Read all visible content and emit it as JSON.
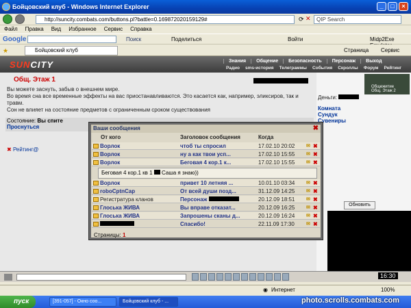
{
  "window": {
    "title": "Бойцовский клуб - Windows Internet Explorer"
  },
  "address": {
    "url": "http://suncity.combats.com/buttons.pl?battle=0.169872020159129#",
    "search_placeholder": "QIP Search"
  },
  "menu": [
    "Файл",
    "Правка",
    "Вид",
    "Избранное",
    "Сервис",
    "Справка"
  ],
  "gbar": {
    "search": "Поиск",
    "share": "Поделиться",
    "enter": "Войти",
    "emulator": "Midp2Exe Emulator",
    "page": "Страница",
    "service": "Сервис"
  },
  "tab": {
    "label": "Бойцовский клуб"
  },
  "site": {
    "logo_a": "SUN",
    "logo_b": "CITY",
    "nav1": [
      "Знания",
      "Общение",
      "Безопасность",
      "Персонаж",
      "Выход"
    ],
    "nav2": [
      "Радио",
      "sms-история",
      "Телеграммы",
      "События",
      "Скроллы",
      "Форум",
      "Рейтинг"
    ]
  },
  "room": {
    "title": "Общ. Этаж 1",
    "text1": "Вы можете заснуть, забыв о внешнем мире.",
    "text2": "Во время сна все временные эффекты на вас приостанавливаются. Это касается как, например, эликсиров, так и травм.",
    "text3": "Сон не влияет на состояние предметов с ограниченным сроком существования",
    "state_label": "Состояние:",
    "state_value": "Вы спите",
    "wake": "Проснуться",
    "rating": "Рейтинг@"
  },
  "right": {
    "money": "Деньги:",
    "links": [
      "Комната",
      "Сундук",
      "Сувениры",
      "и"
    ],
    "refresh": "Обновить",
    "loc1": "Общежитие",
    "loc2": "Общ. Этаж 2"
  },
  "dialog": {
    "title": "Ваши сообщения",
    "col_from": "От кого",
    "col_subject": "Заголовок сообщения",
    "col_when": "Когда",
    "messages": [
      {
        "from": "Ворлок",
        "subject": "чтоб ты спросил",
        "when": "17.02.10 20:02"
      },
      {
        "from": "Ворлок",
        "subject": "ну а как твои усп...",
        "when": "17.02.10 15:55"
      },
      {
        "from": "Ворлок",
        "subject": "Беговая 4 кор.1 к...",
        "when": "17.02.10 15:55"
      },
      {
        "from": "Ворлок",
        "subject": "привет 10 летняя ...",
        "when": "10.01.10 03:34"
      },
      {
        "from": "roboCptnCap",
        "subject": "От всей души позд...",
        "when": "31.12.09 14:25"
      },
      {
        "from": "Регистратура кланов",
        "subject": "Персонаж",
        "when": "20.12.09 18:51"
      },
      {
        "from": "Глоська ЖИВА",
        "subject": "Вы вправе отказат...",
        "when": "20.12.09 16:25"
      },
      {
        "from": "Глоська ЖИВА",
        "subject": "Запрошены сканы д...",
        "when": "20.12.09 16:24"
      },
      {
        "from": "",
        "subject": "Спасибо!",
        "when": "22.11.09 17:30"
      }
    ],
    "expanded_text": "Беговая 4 кор.1 кв 1",
    "expanded_tail": "Саша я знаю))",
    "pages_label": "Страницы:",
    "pages_value": "1"
  },
  "status": {
    "zone": "Интернет",
    "zoom": "100%"
  },
  "taskbar": {
    "start": "пуск",
    "task1": "[391-057] - Окно соо...",
    "task2": "Бойцовский клуб - ...",
    "clock": "16:30"
  },
  "watermark": "photo.scrolls.combats.com"
}
